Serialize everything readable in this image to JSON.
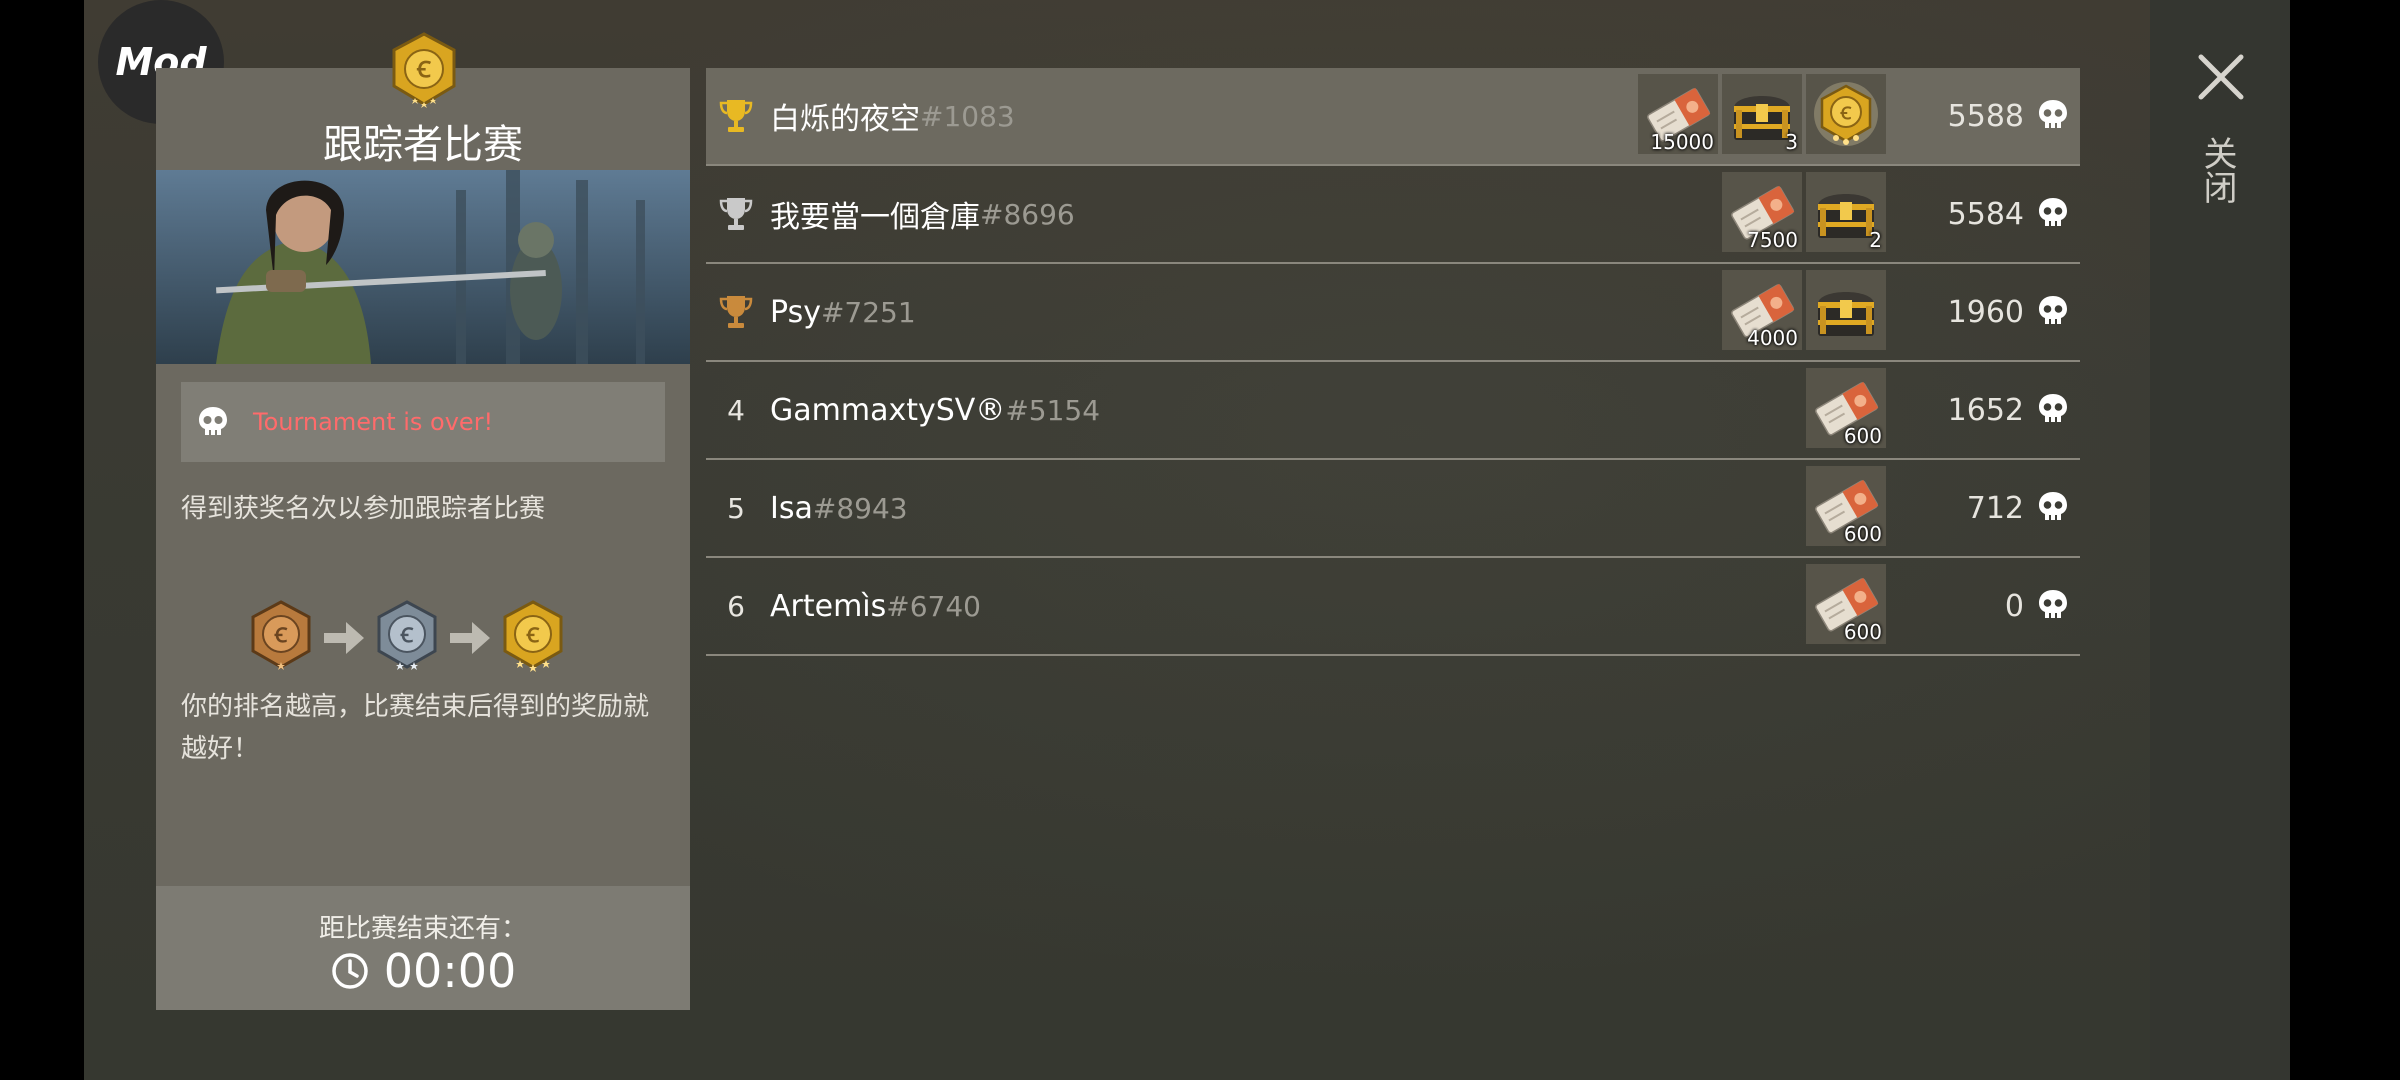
{
  "mod_badge": "Mod",
  "left_panel": {
    "title": "跟踪者比赛",
    "status_text": "Tournament is over!",
    "join_text": "得到获奖名次以参加跟踪者比赛",
    "better_text": "你的排名越高，比赛结束后得到的奖励就越好！",
    "timer_label": "距比赛结束还有：",
    "timer_value": "00:00"
  },
  "leaderboard": [
    {
      "rank": "1",
      "rank_icon": "gold-trophy-icon",
      "name": "白烁的夜空",
      "tag": "#1083",
      "score": "5588",
      "highlight": true,
      "rewards": [
        {
          "icon": "ticket-icon",
          "count": "15000"
        },
        {
          "icon": "chest-icon",
          "count": "3"
        },
        {
          "icon": "gold-medal-icon",
          "count": ""
        }
      ]
    },
    {
      "rank": "2",
      "rank_icon": "silver-trophy-icon",
      "name": "我要當一個倉庫",
      "tag": "#8696",
      "score": "5584",
      "highlight": false,
      "rewards": [
        {
          "icon": "ticket-icon",
          "count": "7500"
        },
        {
          "icon": "chest-icon",
          "count": "2"
        }
      ]
    },
    {
      "rank": "3",
      "rank_icon": "bronze-trophy-icon",
      "name": "Psy",
      "tag": "#7251",
      "score": "1960",
      "highlight": false,
      "rewards": [
        {
          "icon": "ticket-icon",
          "count": "4000"
        },
        {
          "icon": "chest-icon",
          "count": ""
        }
      ]
    },
    {
      "rank": "4",
      "rank_icon": "",
      "name": "GammaxtySV®",
      "tag": "#5154",
      "score": "1652",
      "highlight": false,
      "rewards": [
        {
          "icon": "ticket-icon",
          "count": "600"
        }
      ]
    },
    {
      "rank": "5",
      "rank_icon": "",
      "name": "Isa",
      "tag": "#8943",
      "score": "712",
      "highlight": false,
      "rewards": [
        {
          "icon": "ticket-icon",
          "count": "600"
        }
      ]
    },
    {
      "rank": "6",
      "rank_icon": "",
      "name": "Artemìs",
      "tag": "#6740",
      "score": "0",
      "highlight": false,
      "rewards": [
        {
          "icon": "ticket-icon",
          "count": "600"
        }
      ]
    }
  ],
  "close_label": "关闭",
  "colors": {
    "status_red": "#ff6b6b",
    "gold": "#e8b923",
    "silver": "#c9c9c9",
    "bronze": "#c98a3c"
  }
}
